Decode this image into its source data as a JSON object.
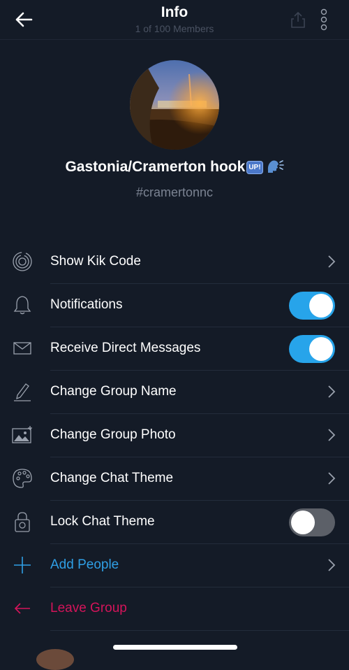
{
  "header": {
    "title": "Info",
    "subtitle": "1 of 100 Members",
    "back_icon": "back-arrow-icon",
    "share_icon": "share-icon",
    "more_icon": "more-vertical-icon"
  },
  "group": {
    "name": "Gastonia/Cramerton hook",
    "badge": "UP!",
    "handle": "#cramertonnc"
  },
  "menu": {
    "kik_code": {
      "label": "Show Kik Code",
      "icon": "kik-code-icon"
    },
    "notifications": {
      "label": "Notifications",
      "icon": "bell-icon",
      "enabled": true
    },
    "direct_messages": {
      "label": "Receive Direct Messages",
      "icon": "envelope-icon",
      "enabled": true
    },
    "change_name": {
      "label": "Change Group Name",
      "icon": "pencil-icon"
    },
    "change_photo": {
      "label": "Change Group Photo",
      "icon": "photo-icon"
    },
    "change_theme": {
      "label": "Change Chat Theme",
      "icon": "palette-icon"
    },
    "lock_theme": {
      "label": "Lock Chat Theme",
      "icon": "lock-palette-icon",
      "enabled": false
    },
    "add_people": {
      "label": "Add People",
      "icon": "plus-icon"
    },
    "leave_group": {
      "label": "Leave Group",
      "icon": "leave-arrow-icon"
    }
  },
  "colors": {
    "background": "#141b27",
    "accent_blue": "#2f9fe5",
    "toggle_on": "#27a4ea",
    "leave_pink": "#d4145a",
    "divider": "#232c3b"
  }
}
